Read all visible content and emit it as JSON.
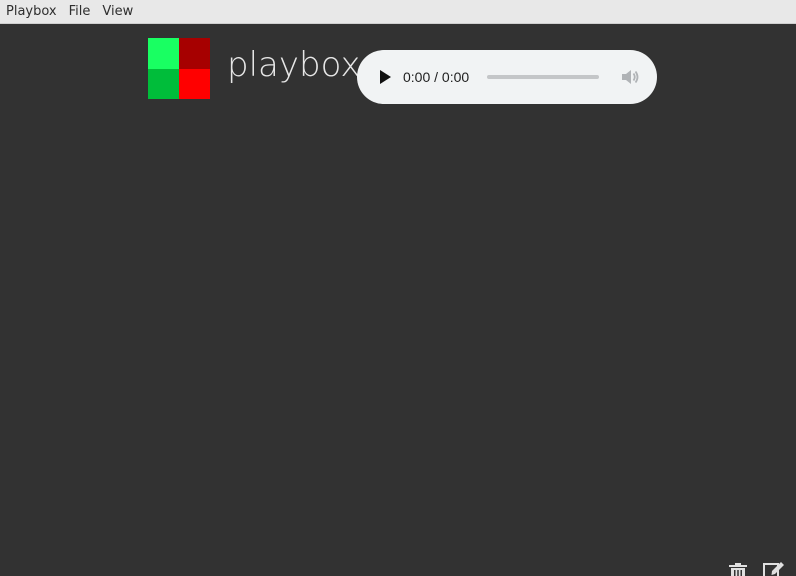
{
  "menubar": {
    "items": [
      {
        "label": "Playbox"
      },
      {
        "label": "File"
      },
      {
        "label": "View"
      }
    ]
  },
  "header": {
    "app_title": "playbox",
    "logo_colors": [
      "#19ff62",
      "#a60000",
      "#00bd3a",
      "#ff0000"
    ]
  },
  "player": {
    "time_display": "0:00 / 0:00",
    "play_icon": "play-icon",
    "volume_icon": "volume-icon"
  },
  "footer_actions": {
    "icons": [
      "trash-icon",
      "edit-icon"
    ]
  },
  "colors": {
    "background": "#323232",
    "menubar": "#e8e8e8",
    "player_bg": "#f1f3f4",
    "title_text": "#e6e6e6"
  }
}
